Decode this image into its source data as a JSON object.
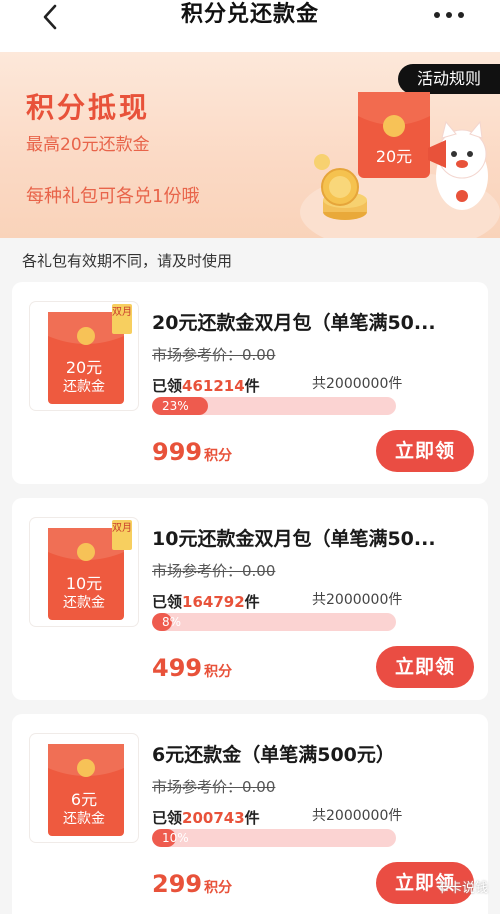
{
  "header": {
    "title": "积分兑还款金"
  },
  "banner": {
    "title": "积分抵现",
    "subtitle": "最高20元还款金",
    "note": "每种礼包可各兑1份哦",
    "rules_label": "活动规则",
    "envelope_amount": "20元"
  },
  "hint": "各礼包有效期不同，请及时使用",
  "products": [
    {
      "title": "20元还款金双月包（单笔满50...",
      "market_price": "市场参考价：0.00",
      "claimed_prefix": "已领",
      "claimed_count": "461214",
      "claimed_suffix": "件",
      "total": "共2000000件",
      "progress": 23,
      "progress_text": "23%",
      "price": "999",
      "price_unit": "积分",
      "button": "立即领",
      "thumb_amount": "20元",
      "thumb_label": "还款金",
      "badge": "双月"
    },
    {
      "title": "10元还款金双月包（单笔满50...",
      "market_price": "市场参考价：0.00",
      "claimed_prefix": "已领",
      "claimed_count": "164792",
      "claimed_suffix": "件",
      "total": "共2000000件",
      "progress": 8,
      "progress_text": "8%",
      "price": "499",
      "price_unit": "积分",
      "button": "立即领",
      "thumb_amount": "10元",
      "thumb_label": "还款金",
      "badge": "双月"
    },
    {
      "title": "6元还款金（单笔满500元）",
      "market_price": "市场参考价：0.00",
      "claimed_prefix": "已领",
      "claimed_count": "200743",
      "claimed_suffix": "件",
      "total": "共2000000件",
      "progress": 10,
      "progress_text": "10%",
      "price": "299",
      "price_unit": "积分",
      "button": "立即领",
      "thumb_amount": "6元",
      "thumb_label": "还款金",
      "badge": ""
    }
  ],
  "watermark": "卡卡说钱",
  "colors": {
    "accent": "#e8523a",
    "button": "#ea4d43",
    "progress_track": "#fbd3d2",
    "progress_fill": "#ee5b4e"
  }
}
